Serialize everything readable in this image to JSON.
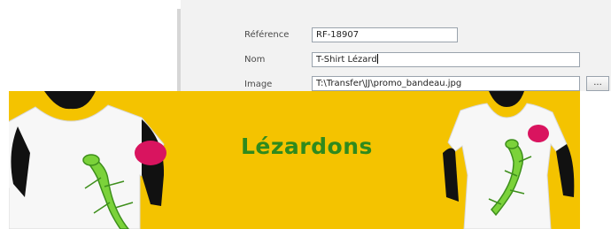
{
  "form": {
    "reference": {
      "label": "Référence",
      "value": "RF-18907"
    },
    "nom": {
      "label": "Nom",
      "value": "T-Shirt Lézard"
    },
    "image": {
      "label": "Image",
      "value": "T:\\Transfer\\JJ\\promo_bandeau.jpg",
      "browse_label": "..."
    }
  },
  "banner": {
    "headline": "Lézardons",
    "background_color": "#f4c300",
    "headline_color": "#2f8a1d",
    "images": [
      "tshirt-mannequin-left",
      "tshirt-mannequin-right"
    ]
  }
}
